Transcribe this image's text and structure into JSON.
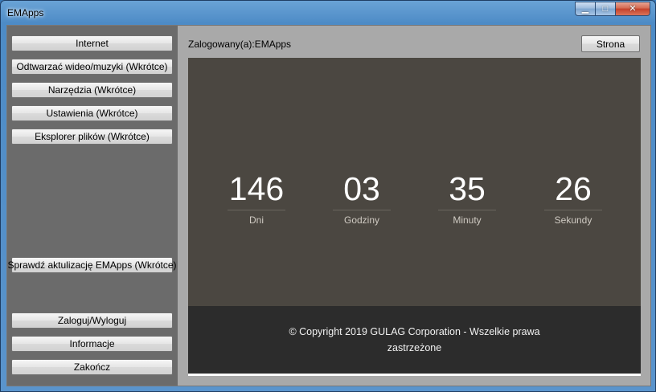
{
  "window": {
    "title": "EMApps",
    "minimize_glyph": "▁",
    "maximize_glyph": "□",
    "close_glyph": "✕"
  },
  "sidebar": {
    "buttons": [
      {
        "label": "Internet"
      },
      {
        "label": "Odtwarzać wideo/muzyki (Wkrótce)"
      },
      {
        "label": "Narzędzia (Wkrótce)"
      },
      {
        "label": "Ustawienia (Wkrótce)"
      },
      {
        "label": "Eksplorer plików (Wkrótce)"
      },
      {
        "label": "Sprawdź aktulizację EMApps (Wkrótce)"
      },
      {
        "label": "Zaloguj/Wyloguj"
      },
      {
        "label": "Informacje"
      },
      {
        "label": "Zakończ"
      }
    ]
  },
  "header": {
    "logged_in": "Zalogowany(a):EMApps",
    "strona_label": "Strona"
  },
  "countdown": {
    "days": "146",
    "days_label": "Dni",
    "hours": "03",
    "hours_label": "Godziny",
    "minutes": "35",
    "minutes_label": "Minuty",
    "seconds": "26",
    "seconds_label": "Sekundy"
  },
  "footer": {
    "copyright": "© Copyright 2019 GULAG Corporation - Wszelkie prawa zastrzeżone"
  },
  "colors": {
    "countdown_bg": "#4b4741",
    "footer_bg": "#2c2c2c",
    "sidebar_bg": "#6b6b6b"
  }
}
